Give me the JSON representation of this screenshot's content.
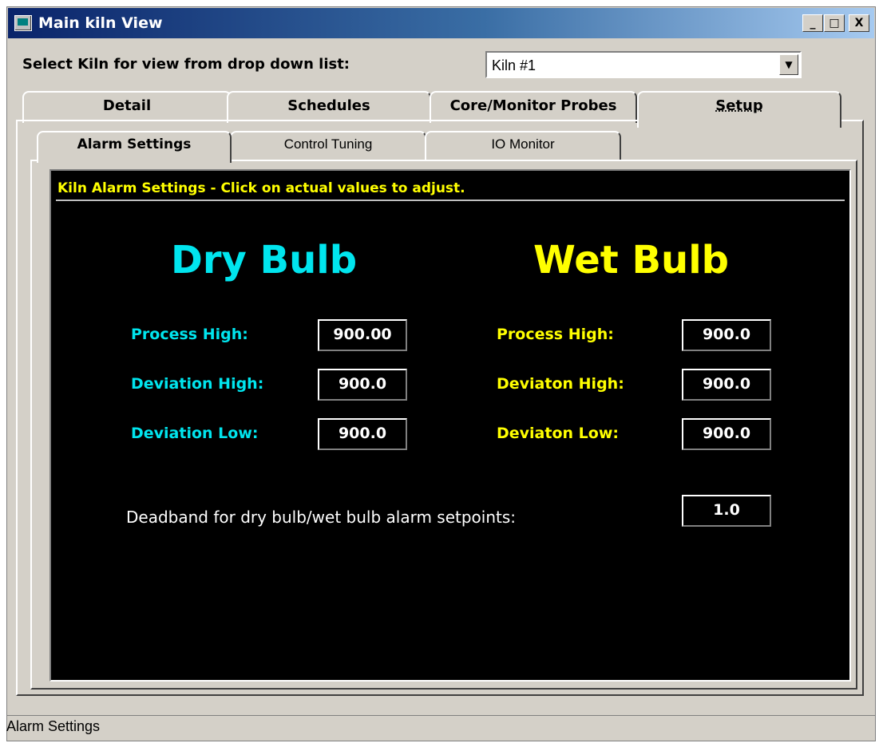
{
  "window": {
    "title": "Main kiln View",
    "min_glyph": "_",
    "max_glyph": "□",
    "close_glyph": "X"
  },
  "kiln_select": {
    "label": "Select Kiln for view from drop down list:",
    "value": "Kiln #1",
    "arrow": "▼"
  },
  "main_tabs": [
    {
      "label": "Detail"
    },
    {
      "label": "Schedules"
    },
    {
      "label": "Core/Monitor Probes"
    },
    {
      "label": "Setup",
      "active": true
    }
  ],
  "sub_tabs": [
    {
      "label": "Alarm Settings",
      "active": true
    },
    {
      "label": "Control Tuning"
    },
    {
      "label": "IO Monitor"
    }
  ],
  "alarm": {
    "header": "Kiln Alarm Settings - Click on actual values to adjust.",
    "dry": {
      "title": "Dry Bulb",
      "process_high_label": "Process High:",
      "process_high_value": "900.00",
      "deviation_high_label": "Deviation High:",
      "deviation_high_value": "900.0",
      "deviation_low_label": "Deviation Low:",
      "deviation_low_value": "900.0"
    },
    "wet": {
      "title": "Wet Bulb",
      "process_high_label": "Process High:",
      "process_high_value": "900.0",
      "deviation_high_label": "Deviaton High:",
      "deviation_high_value": "900.0",
      "deviation_low_label": "Deviaton Low:",
      "deviation_low_value": "900.0"
    },
    "deadband_label": "Deadband for dry bulb/wet bulb alarm setpoints:",
    "deadband_value": "1.0"
  },
  "status_bar": {
    "text": "Alarm Settings"
  },
  "colors": {
    "dry": "#00e5ee",
    "wet": "#ffff00",
    "header": "#ffff00",
    "screen_bg": "#000000"
  }
}
